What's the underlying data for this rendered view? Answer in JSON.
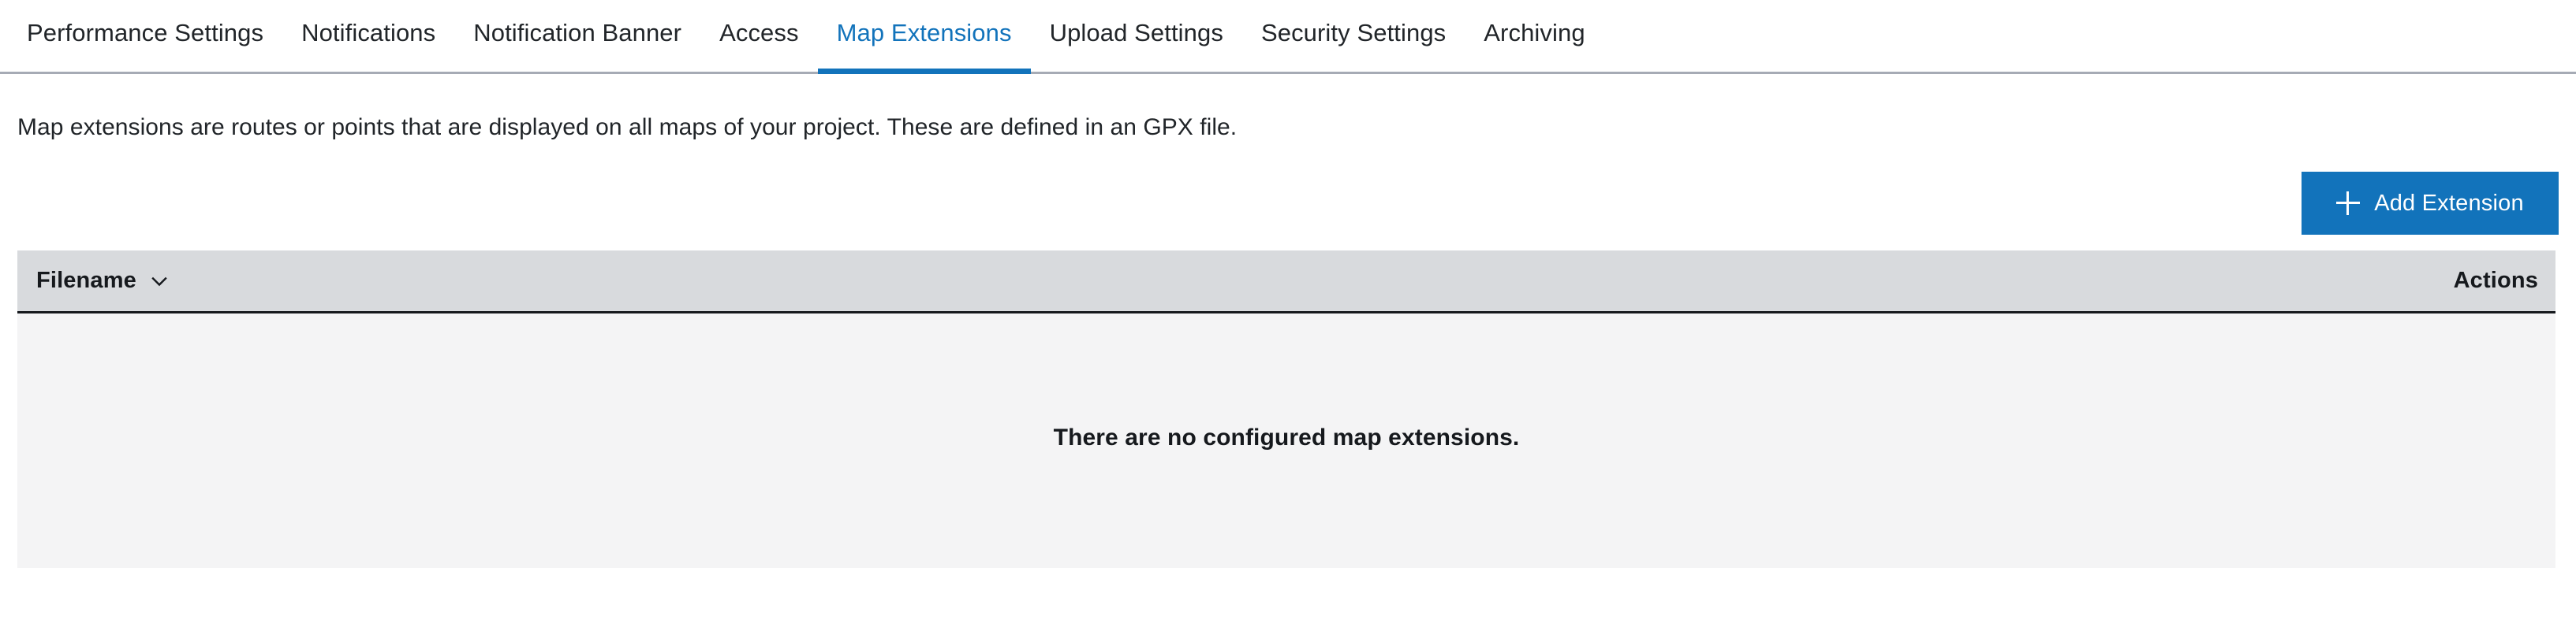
{
  "tabs": [
    {
      "label": "Performance Settings",
      "active": false
    },
    {
      "label": "Notifications",
      "active": false
    },
    {
      "label": "Notification Banner",
      "active": false
    },
    {
      "label": "Access",
      "active": false
    },
    {
      "label": "Map Extensions",
      "active": true
    },
    {
      "label": "Upload Settings",
      "active": false
    },
    {
      "label": "Security Settings",
      "active": false
    },
    {
      "label": "Archiving",
      "active": false
    }
  ],
  "main": {
    "description": "Map extensions are routes or points that are displayed on all maps of your project. These are defined in an GPX file.",
    "add_button_label": "Add Extension",
    "add_button_icon": "plus-icon"
  },
  "table": {
    "columns": [
      {
        "label": "Filename",
        "sort_icon": "chevron-down-icon"
      },
      {
        "label": "Actions"
      }
    ],
    "rows": [],
    "empty_message": "There are no configured map extensions."
  },
  "colors": {
    "accent": "#1273bb",
    "tabbar_border": "#a6abb5",
    "table_header_bg": "#d8dadd",
    "table_body_bg": "#f4f4f5",
    "text": "#212529"
  }
}
